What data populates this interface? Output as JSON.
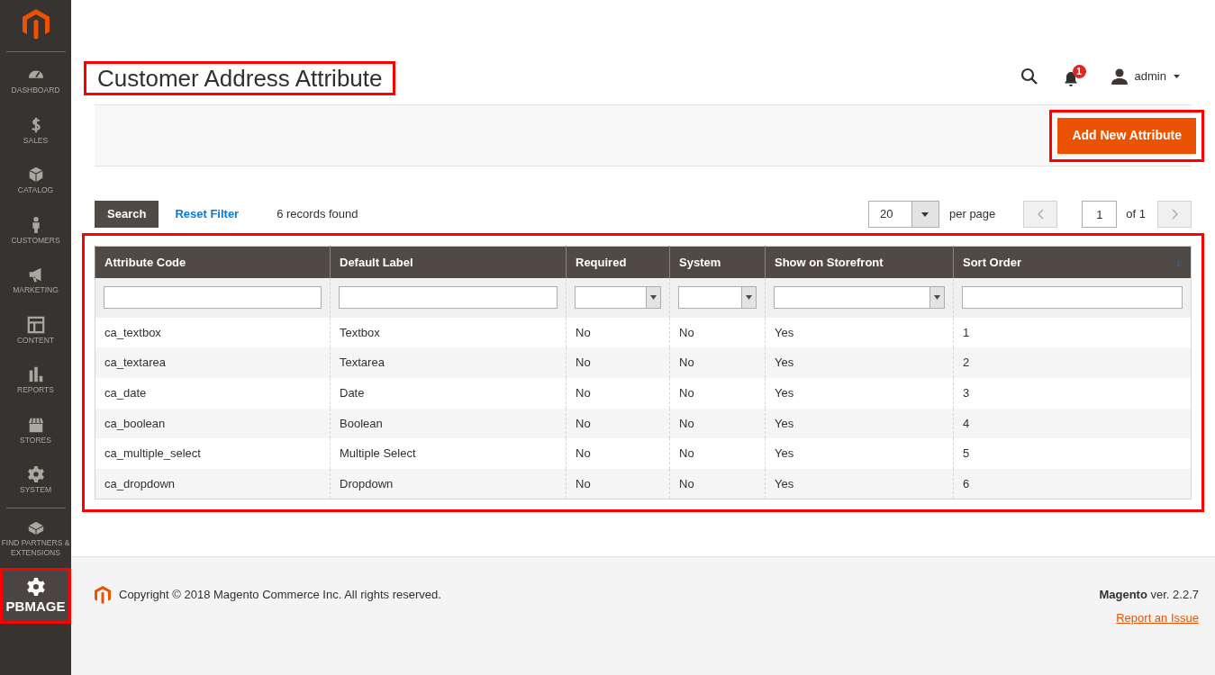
{
  "sidebar": {
    "items": [
      {
        "label": "DASHBOARD",
        "selected": false,
        "highlighted": false
      },
      {
        "label": "SALES",
        "selected": false,
        "highlighted": false
      },
      {
        "label": "CATALOG",
        "selected": false,
        "highlighted": false
      },
      {
        "label": "CUSTOMERS",
        "selected": false,
        "highlighted": false
      },
      {
        "label": "MARKETING",
        "selected": false,
        "highlighted": false
      },
      {
        "label": "CONTENT",
        "selected": false,
        "highlighted": false
      },
      {
        "label": "REPORTS",
        "selected": false,
        "highlighted": false
      },
      {
        "label": "STORES",
        "selected": false,
        "highlighted": false
      },
      {
        "label": "SYSTEM",
        "selected": false,
        "highlighted": false
      },
      {
        "label": "FIND PARTNERS & EXTENSIONS",
        "selected": false,
        "highlighted": false
      },
      {
        "label": "PBMAGE",
        "selected": true,
        "highlighted": true
      }
    ]
  },
  "header": {
    "title": "Customer Address Attribute",
    "title_highlighted": true,
    "notification_count": "1",
    "user": "admin"
  },
  "actions": {
    "button": "Add New Attribute",
    "highlighted": true
  },
  "toolbar": {
    "search_button": "Search",
    "reset_link": "Reset Filter",
    "records": "6 records found",
    "per_page_value": "20",
    "per_page_label": "per page",
    "page": "1",
    "page_total": "of 1"
  },
  "grid": {
    "highlighted": true,
    "columns": [
      {
        "label": "Attribute Code",
        "kind": "text"
      },
      {
        "label": "Default Label",
        "kind": "text"
      },
      {
        "label": "Required",
        "kind": "select"
      },
      {
        "label": "System",
        "kind": "select"
      },
      {
        "label": "Show on Storefront",
        "kind": "select"
      },
      {
        "label": "Sort Order",
        "kind": "text",
        "sort_arrow": "↓"
      }
    ],
    "rows": [
      [
        "ca_textbox",
        "Textbox",
        "No",
        "No",
        "Yes",
        "1"
      ],
      [
        "ca_textarea",
        "Textarea",
        "No",
        "No",
        "Yes",
        "2"
      ],
      [
        "ca_date",
        "Date",
        "No",
        "No",
        "Yes",
        "3"
      ],
      [
        "ca_boolean",
        "Boolean",
        "No",
        "No",
        "Yes",
        "4"
      ],
      [
        "ca_multiple_select",
        "Multiple Select",
        "No",
        "No",
        "Yes",
        "5"
      ],
      [
        "ca_dropdown",
        "Dropdown",
        "No",
        "No",
        "Yes",
        "6"
      ]
    ]
  },
  "footer": {
    "copyright": "Copyright © 2018 Magento Commerce Inc. All rights reserved.",
    "version": "**Magento** ver. 2.2.7",
    "report_link": "Report an Issue"
  }
}
